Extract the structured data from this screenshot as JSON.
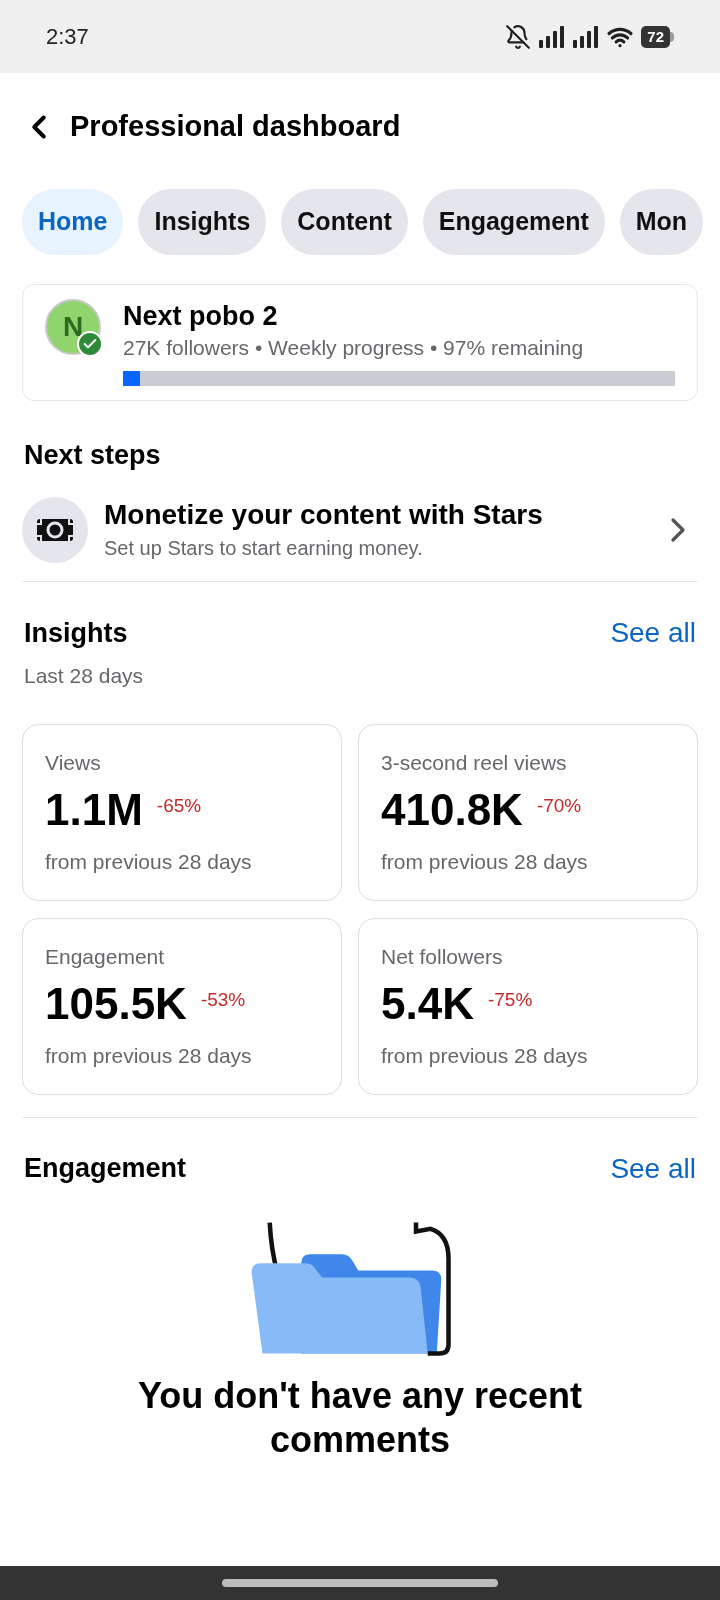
{
  "status_bar": {
    "time": "2:37",
    "battery": "72"
  },
  "header": {
    "title": "Professional dashboard"
  },
  "tabs": [
    {
      "label": "Home",
      "selected": true
    },
    {
      "label": "Insights",
      "selected": false
    },
    {
      "label": "Content",
      "selected": false
    },
    {
      "label": "Engagement",
      "selected": false
    },
    {
      "label": "Mon",
      "selected": false
    }
  ],
  "profile": {
    "initial": "N",
    "verified": true,
    "name": "Next pobo 2",
    "meta": "27K followers • Weekly progress • 97% remaining",
    "level": 0.03
  },
  "next_steps": {
    "title": "Next steps",
    "item": {
      "title": "Monetize your content with Stars",
      "subtitle": "Set up Stars to start earning money."
    }
  },
  "insights": {
    "title": "Insights",
    "link": "See all",
    "subtitle": "Last 28 days",
    "cards": [
      {
        "label": "Views",
        "value": "1.1M",
        "change": "-65%",
        "note": "from previous 28 days"
      },
      {
        "label": "3-second reel views",
        "value": "410.8K",
        "change": "-70%",
        "note": "from previous 28 days"
      },
      {
        "label": "Engagement",
        "value": "105.5K",
        "change": "-53%",
        "note": "from previous 28 days"
      },
      {
        "label": "Net followers",
        "value": "5.4K",
        "change": "-75%",
        "note": "from previous 28 days"
      }
    ]
  },
  "engagement": {
    "title": "Engagement",
    "link": "See all",
    "empty_message": "You don't have any recent comments"
  }
}
